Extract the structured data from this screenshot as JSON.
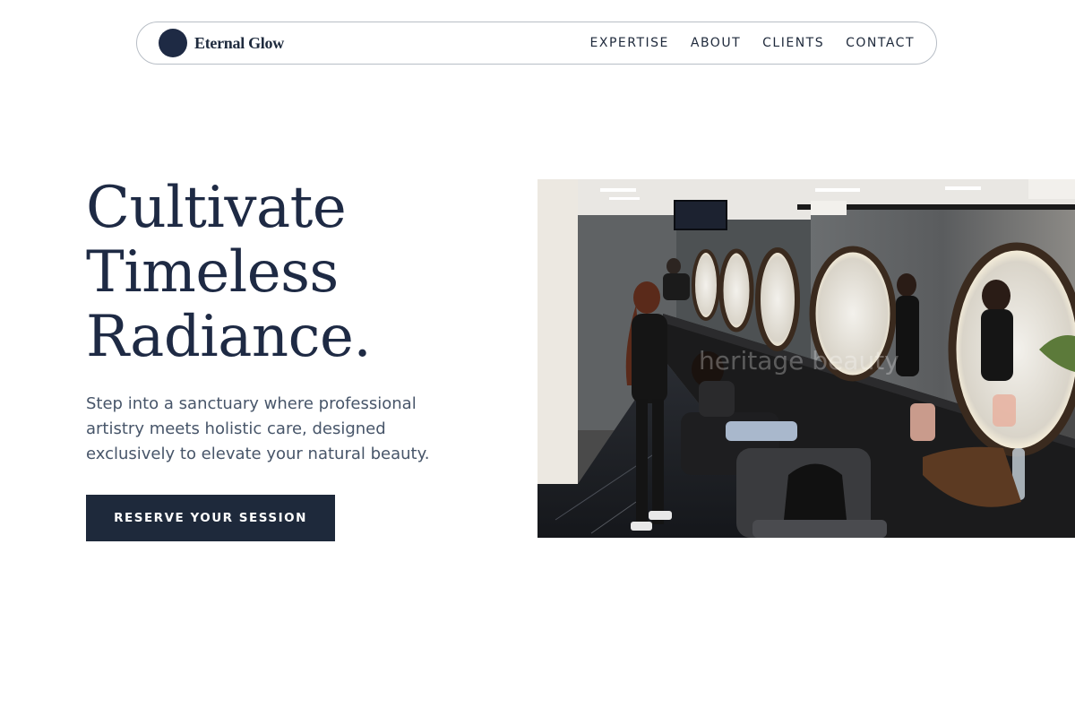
{
  "header": {
    "brand_name": "Eternal Glow",
    "nav_items": [
      {
        "label": "EXPERTISE"
      },
      {
        "label": "ABOUT"
      },
      {
        "label": "CLIENTS"
      },
      {
        "label": "CONTACT"
      }
    ]
  },
  "hero": {
    "title_lines": [
      "Cultivate",
      "Timeless",
      "Radiance."
    ],
    "subtitle": "Step into a sanctuary where professional artistry meets holistic care, designed exclusively to elevate your natural beauty.",
    "cta_label": "RESERVE YOUR SESSION",
    "image": {
      "subject": "salon interior with stylists and round lit mirrors",
      "watermark": "heritage beauty"
    }
  },
  "colors": {
    "brand": "#1e2a44",
    "text": "#1e293b",
    "muted": "#475569",
    "border": "#b8bec6"
  }
}
